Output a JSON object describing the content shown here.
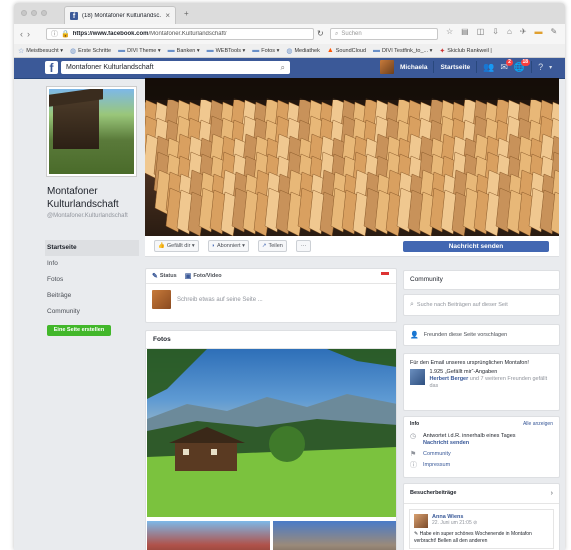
{
  "browser": {
    "tab_title": "(18) Montafoner Kulturlandsc...",
    "tab_close": "×",
    "new_tab": "+",
    "url_domain": "https://www.facebook.com",
    "url_path": "/Montafoner.Kulturlandschaft/",
    "search_placeholder": "Suchen",
    "bookmarks": [
      {
        "label": "Meistbesucht ▾",
        "icon": "star-icon"
      },
      {
        "label": "Erste Schritte",
        "icon": "globe-icon"
      },
      {
        "label": "DIVI Theme ▾",
        "icon": "folder-icon"
      },
      {
        "label": "Banken ▾",
        "icon": "folder-icon"
      },
      {
        "label": "WEBTools ▾",
        "icon": "folder-icon"
      },
      {
        "label": "Fotos ▾",
        "icon": "folder-icon"
      },
      {
        "label": "Mediathek",
        "icon": "globe-icon"
      },
      {
        "label": "SoundCloud",
        "icon": "soundcloud-icon"
      },
      {
        "label": "DIVI Testfink_to_... ▾",
        "icon": "folder-icon"
      },
      {
        "label": "Skiclub Rankweil |",
        "icon": "ski-icon"
      }
    ]
  },
  "fb": {
    "search_value": "Montafoner Kulturlandschaft",
    "user_name": "Michaela",
    "home_label": "Startseite",
    "messages_badge": "2",
    "notifications_badge": "18"
  },
  "page": {
    "name": "Montafoner Kulturlandschaft",
    "handle": "@Montafoner.Kulturlandschaft",
    "nav": [
      "Startseite",
      "Info",
      "Fotos",
      "Beiträge",
      "Community"
    ],
    "create_page": "Eine Seite erstellen"
  },
  "actions": {
    "like": "Gefällt dir ▾",
    "follow": "Abonniert ▾",
    "share": "Teilen",
    "more": "···",
    "message": "Nachricht senden"
  },
  "composer": {
    "status": "Status",
    "photo": "Foto/Video",
    "placeholder": "Schreib etwas auf seine Seite ..."
  },
  "photos": {
    "title": "Fotos"
  },
  "sidebar": {
    "community": "Community",
    "search_placeholder": "Suche nach Beiträgen auf dieser Seit",
    "invite": "Freunden diese Seite vorschlagen",
    "email_title": "Für den Email unseres ursprünglichen Montafon!",
    "likes_count": "1.925 „Gefällt mir“-Angaben",
    "likes_friend": "Herbert Berger",
    "likes_rest": "und 7 weiteren Freunden gefällt das",
    "info_label": "Info",
    "info_all": "Alle anzeigen",
    "response": "Antwortet i.d.R. innerhalb eines Tages",
    "send_message": "Nachricht senden",
    "community_link": "Community",
    "impressum": "Impressum",
    "visitor_title": "Besucherbeiträge",
    "visitor_name": "Anna Wiens",
    "visitor_date": "22. Juni um 21:05 ⊘",
    "visitor_text": "Habe ein super schönes Wochenende in Montafon verbracht! Bellen all den anderen"
  }
}
